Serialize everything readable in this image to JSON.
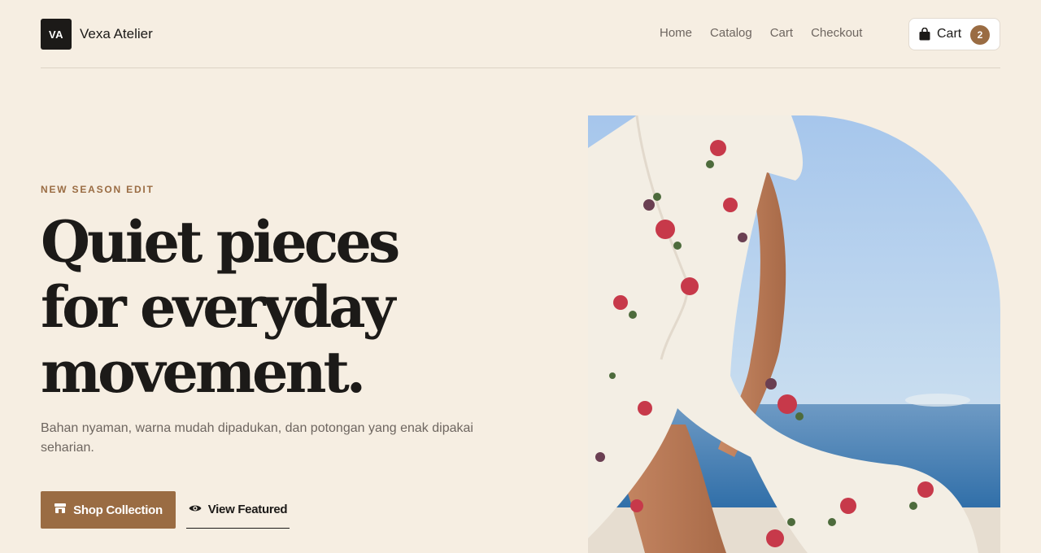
{
  "brand": {
    "logo_text": "VA",
    "name": "Vexa Atelier"
  },
  "nav": {
    "items": [
      "Home",
      "Catalog",
      "Cart",
      "Checkout"
    ]
  },
  "cart": {
    "label": "Cart",
    "count": "2",
    "icon": "shopping-bag-icon"
  },
  "hero": {
    "eyebrow": "NEW SEASON EDIT",
    "headline": "Quiet pieces for everyday movement.",
    "subtext": "Bahan nyaman, warna mudah dipadukan, dan potongan yang enak dipakai seharian.",
    "primary_button": {
      "label": "Shop Collection",
      "icon": "store-icon"
    },
    "secondary_button": {
      "label": "View Featured",
      "icon": "eye-icon"
    },
    "image_alt": "model-in-floral-dress"
  },
  "colors": {
    "background": "#f6eee2",
    "accent": "#9a6c43",
    "text": "#1c1a18",
    "muted": "#6e6660"
  }
}
